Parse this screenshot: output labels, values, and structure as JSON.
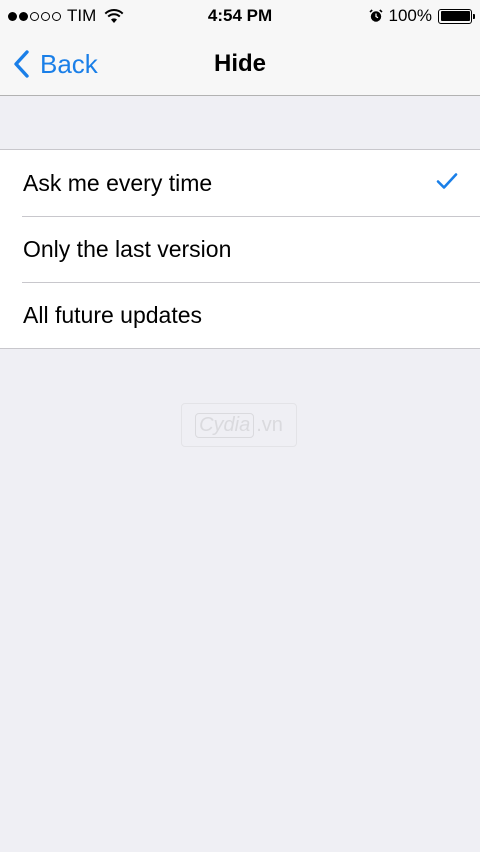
{
  "status_bar": {
    "carrier": "TIM",
    "time": "4:54 PM",
    "battery": "100%",
    "signal_bars_filled": 2,
    "signal_bars_total": 5
  },
  "nav": {
    "back_label": "Back",
    "title": "Hide"
  },
  "options": [
    {
      "label": "Ask me every time",
      "selected": true
    },
    {
      "label": "Only the last version",
      "selected": false
    },
    {
      "label": "All future updates",
      "selected": false
    }
  ],
  "watermark": {
    "brand": "Cydia",
    "suffix": ".vn"
  },
  "colors": {
    "accent": "#1a7fe8",
    "background": "#efeff4",
    "bar": "#f7f7f7"
  },
  "icons": {
    "back": "chevron-left-icon",
    "check": "checkmark-icon",
    "wifi": "wifi-icon",
    "alarm": "alarm-clock-icon",
    "battery": "battery-icon"
  }
}
